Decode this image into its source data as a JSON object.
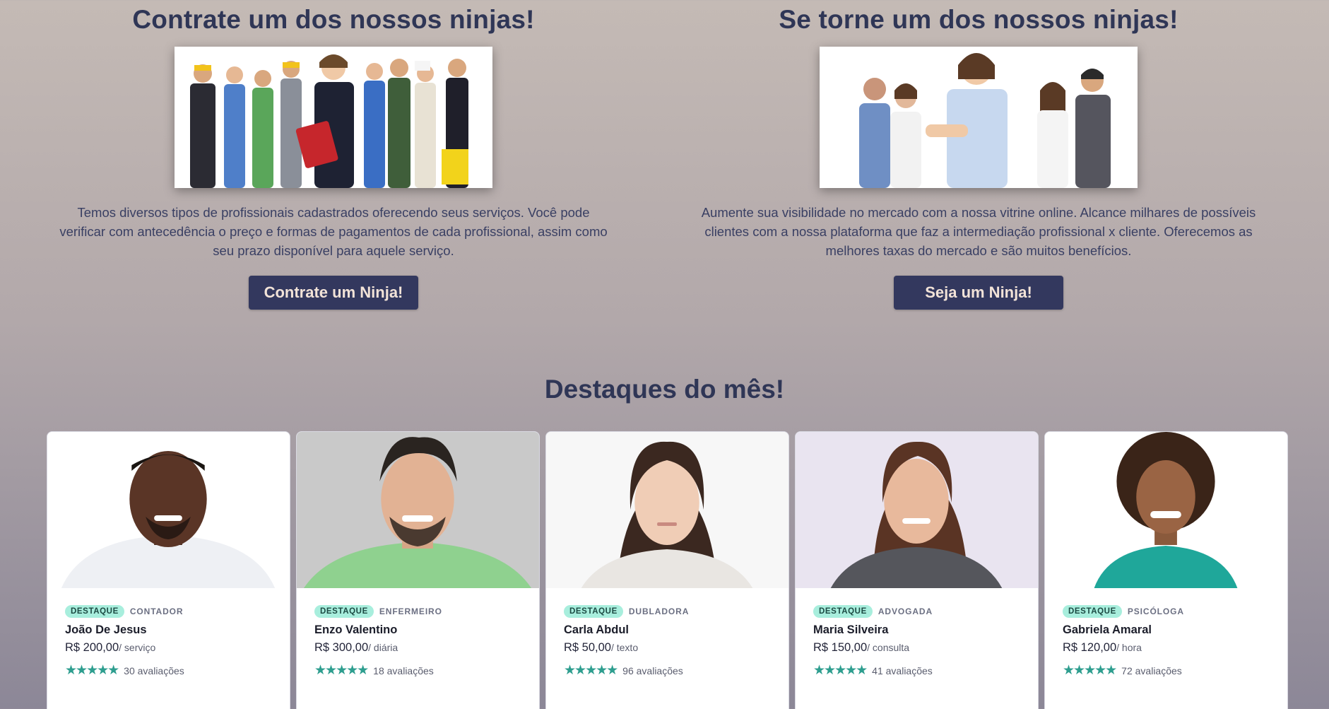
{
  "hire": {
    "title": "Contrate um dos nossos ninjas!",
    "description": "Temos diversos tipos de profissionais cadastrados oferecendo seus serviços. Você pode verificar com antecedência o preço e formas de pagamentos de cada profissional, assim como seu prazo disponível para aquele serviço.",
    "button_label": "Contrate um Ninja!"
  },
  "join": {
    "title": "Se torne um dos nossos ninjas!",
    "description": "Aumente sua visibilidade no mercado com a nossa vitrine online. Alcance milhares de possíveis clientes com a nossa plataforma que faz a intermediação profissional x cliente. Oferecemos as melhores taxas do mercado e são muitos benefícios.",
    "button_label": "Seja um Ninja!"
  },
  "highlights": {
    "title": "Destaques do mês!",
    "cards": [
      {
        "badge": "DESTAQUE",
        "role": "CONTADOR",
        "name": "João De Jesus",
        "price": "R$ 200,00",
        "unit": "/ serviço",
        "stars": "★★★★★",
        "reviews": "30 avaliações",
        "rating": 5
      },
      {
        "badge": "DESTAQUE",
        "role": "ENFERMEIRO",
        "name": "Enzo Valentino",
        "price": "R$ 300,00",
        "unit": "/ diária",
        "stars": "★★★★★",
        "reviews": "18 avaliações",
        "rating": 5
      },
      {
        "badge": "DESTAQUE",
        "role": "DUBLADORA",
        "name": "Carla Abdul",
        "price": "R$ 50,00",
        "unit": "/ texto",
        "stars": "★★★★★",
        "reviews": "96 avaliações",
        "rating": 5
      },
      {
        "badge": "DESTAQUE",
        "role": "ADVOGADA",
        "name": "Maria Silveira",
        "price": "R$ 150,00",
        "unit": "/ consulta",
        "stars": "★★★★★",
        "reviews": "41 avaliações",
        "rating": 5
      },
      {
        "badge": "DESTAQUE",
        "role": "PSICÓLOGA",
        "name": "Gabriela Amaral",
        "price": "R$ 120,00",
        "unit": "/ hora",
        "stars": "★★★★★",
        "reviews": "72 avaliações",
        "rating": 5
      }
    ]
  },
  "colors": {
    "primary": "#33385e",
    "heading": "#2f3656",
    "badge_bg": "#a8eedd",
    "star": "#2e9e8f"
  }
}
